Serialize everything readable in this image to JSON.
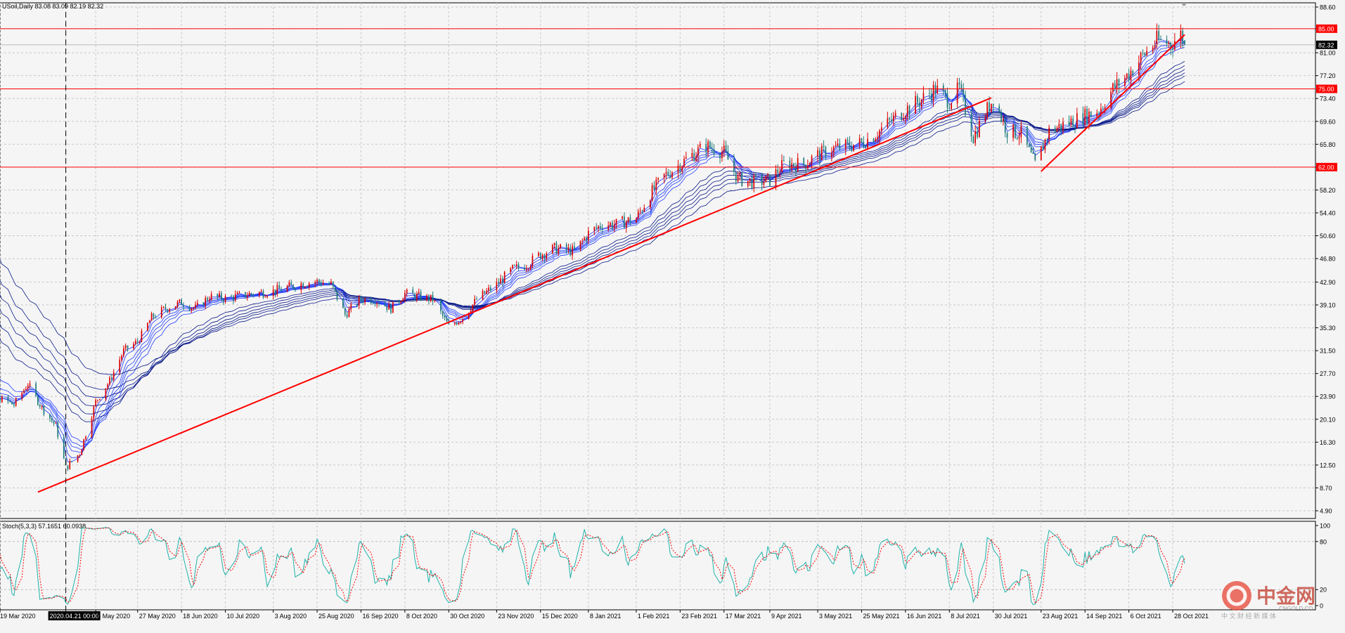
{
  "chart_data": [
    {
      "type": "candlestick",
      "symbol_label": "USoil,Daily",
      "ohlc_label": "83.08 83.09 82.19 82.32",
      "y_ticks": [
        "88.60",
        "85.00",
        "81.00",
        "77.20",
        "73.40",
        "69.60",
        "65.80",
        "62.00",
        "58.20",
        "54.40",
        "50.60",
        "46.80",
        "42.90",
        "39.10",
        "35.30",
        "31.50",
        "27.70",
        "23.90",
        "20.10",
        "16.30",
        "12.50",
        "8.70",
        "4.90"
      ],
      "ylim": [
        4.9,
        88.6
      ],
      "x_ticks": [
        "19 Mar 2020",
        "2020.04.21 00:00",
        "6 May 2020",
        "27 May 2020",
        "18 Jun 2020",
        "10 Jul 2020",
        "3 Aug 2020",
        "25 Aug 2020",
        "16 Sep 2020",
        "8 Oct 2020",
        "30 Oct 2020",
        "23 Nov 2020",
        "15 Dec 2020",
        "8 Jan 2021",
        "1 Feb 2021",
        "23 Feb 2021",
        "17 Mar 2021",
        "9 Apr 2021",
        "3 May 2021",
        "25 May 2021",
        "16 Jun 2021",
        "8 Jul 2021",
        "30 Jul 2021",
        "23 Aug 2021",
        "14 Sep 2021",
        "6 Oct 2021",
        "28 Oct 2021"
      ],
      "current_price": "82.32",
      "horizontal_levels": [
        {
          "label": "85.00",
          "value": 85.0,
          "color": "#ff0000"
        },
        {
          "label": "75.00",
          "value": 75.0,
          "color": "#ff0000"
        },
        {
          "label": "62.00",
          "value": 62.0,
          "color": "#ff0000"
        }
      ],
      "trendlines": [
        {
          "from": [
            "2020-04-07",
            8.0
          ],
          "to": [
            "2021-07-29",
            73.5
          ],
          "color": "#ff0000"
        },
        {
          "from": [
            "2021-08-23",
            61.3
          ],
          "to": [
            "2021-11-03",
            84.0
          ],
          "color": "#ff0000"
        }
      ],
      "vertical_marker": "2020.04.21 00:00",
      "close_series": [
        [
          "2020-03-19",
          23.5
        ],
        [
          "2020-03-26",
          22.5
        ],
        [
          "2020-04-02",
          26.0
        ],
        [
          "2020-04-09",
          22.0
        ],
        [
          "2020-04-16",
          19.0
        ],
        [
          "2020-04-21",
          12.0
        ],
        [
          "2020-04-28",
          14.5
        ],
        [
          "2020-05-06",
          23.0
        ],
        [
          "2020-05-13",
          26.5
        ],
        [
          "2020-05-20",
          31.5
        ],
        [
          "2020-05-27",
          33.0
        ],
        [
          "2020-06-03",
          37.0
        ],
        [
          "2020-06-10",
          38.5
        ],
        [
          "2020-06-18",
          39.5
        ],
        [
          "2020-06-25",
          38.5
        ],
        [
          "2020-07-02",
          40.5
        ],
        [
          "2020-07-10",
          40.2
        ],
        [
          "2020-07-17",
          40.6
        ],
        [
          "2020-07-24",
          41.0
        ],
        [
          "2020-08-03",
          41.4
        ],
        [
          "2020-08-10",
          42.0
        ],
        [
          "2020-08-18",
          42.7
        ],
        [
          "2020-08-25",
          43.0
        ],
        [
          "2020-09-01",
          42.5
        ],
        [
          "2020-09-08",
          37.5
        ],
        [
          "2020-09-16",
          40.0
        ],
        [
          "2020-09-23",
          40.0
        ],
        [
          "2020-10-01",
          38.5
        ],
        [
          "2020-10-08",
          41.0
        ],
        [
          "2020-10-15",
          40.5
        ],
        [
          "2020-10-22",
          40.0
        ],
        [
          "2020-10-30",
          35.5
        ],
        [
          "2020-11-06",
          37.0
        ],
        [
          "2020-11-13",
          40.0
        ],
        [
          "2020-11-23",
          42.5
        ],
        [
          "2020-12-01",
          45.0
        ],
        [
          "2020-12-08",
          45.8
        ],
        [
          "2020-12-15",
          47.5
        ],
        [
          "2020-12-22",
          48.5
        ],
        [
          "2021-01-01",
          48.0
        ],
        [
          "2021-01-08",
          51.0
        ],
        [
          "2021-01-15",
          52.5
        ],
        [
          "2021-01-22",
          52.5
        ],
        [
          "2021-02-01",
          53.5
        ],
        [
          "2021-02-08",
          57.5
        ],
        [
          "2021-02-15",
          60.5
        ],
        [
          "2021-02-23",
          62.5
        ],
        [
          "2021-03-01",
          64.0
        ],
        [
          "2021-03-08",
          65.5
        ],
        [
          "2021-03-17",
          64.5
        ],
        [
          "2021-03-24",
          60.0
        ],
        [
          "2021-04-01",
          59.5
        ],
        [
          "2021-04-09",
          59.8
        ],
        [
          "2021-04-16",
          62.5
        ],
        [
          "2021-04-26",
          62.5
        ],
        [
          "2021-05-03",
          64.0
        ],
        [
          "2021-05-10",
          65.0
        ],
        [
          "2021-05-17",
          65.5
        ],
        [
          "2021-05-25",
          66.0
        ],
        [
          "2021-06-01",
          67.5
        ],
        [
          "2021-06-08",
          69.5
        ],
        [
          "2021-06-16",
          71.5
        ],
        [
          "2021-06-23",
          73.0
        ],
        [
          "2021-07-01",
          75.0
        ],
        [
          "2021-07-08",
          73.0
        ],
        [
          "2021-07-13",
          75.0
        ],
        [
          "2021-07-20",
          67.0
        ],
        [
          "2021-07-30",
          73.5
        ],
        [
          "2021-08-06",
          68.0
        ],
        [
          "2021-08-13",
          67.5
        ],
        [
          "2021-08-20",
          62.3
        ],
        [
          "2021-08-27",
          68.0
        ],
        [
          "2021-09-03",
          69.0
        ],
        [
          "2021-09-14",
          70.5
        ],
        [
          "2021-09-21",
          71.5
        ],
        [
          "2021-09-28",
          75.0
        ],
        [
          "2021-10-06",
          77.5
        ],
        [
          "2021-10-13",
          80.5
        ],
        [
          "2021-10-20",
          83.0
        ],
        [
          "2021-10-27",
          82.5
        ],
        [
          "2021-11-01",
          84.0
        ],
        [
          "2021-11-03",
          82.3
        ]
      ]
    },
    {
      "type": "line",
      "title": "Stoch(5,3,3) 57.1651 60.0938",
      "y_ticks": [
        "100",
        "80",
        "20",
        "0"
      ],
      "ylim": [
        0,
        100
      ],
      "series": [
        {
          "name": "main",
          "color": "#20b2aa"
        },
        {
          "name": "signal",
          "color": "#ff0000"
        }
      ]
    }
  ],
  "watermark": {
    "brand": "中金网",
    "domain": "CNGOLD.CO",
    "slogan": "中 文 财 经 新 媒 体"
  }
}
